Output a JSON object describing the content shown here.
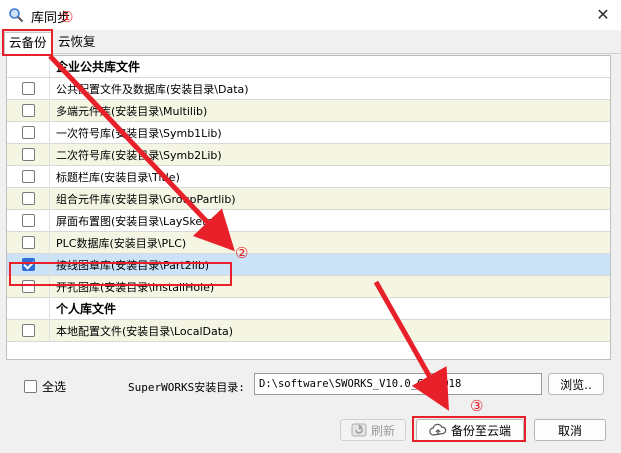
{
  "window": {
    "title": "库同步",
    "close_glyph": "✕"
  },
  "tabs": [
    {
      "label": "云备份",
      "active": true
    },
    {
      "label": "云恢复",
      "active": false
    }
  ],
  "sections": {
    "enterprise": "企业公共库文件",
    "personal": "个人库文件"
  },
  "items": [
    {
      "label": "公共配置文件及数据库(安装目录\\Data)",
      "checked": false
    },
    {
      "label": "多端元件库(安装目录\\Multilib)",
      "checked": false
    },
    {
      "label": "一次符号库(安装目录\\Symb1Lib)",
      "checked": false
    },
    {
      "label": "二次符号库(安装目录\\Symb2Lib)",
      "checked": false
    },
    {
      "label": "标题栏库(安装目录\\Title)",
      "checked": false
    },
    {
      "label": "组合元件库(安装目录\\GroupPartlib)",
      "checked": false
    },
    {
      "label": "屏面布置图(安装目录\\LaySketch)",
      "checked": false
    },
    {
      "label": "PLC数据库(安装目录\\PLC)",
      "checked": false
    },
    {
      "label": "接线图章库(安装目录\\Part2lib)",
      "checked": true
    },
    {
      "label": "开孔图库(安装目录\\InstallHole)",
      "checked": false
    },
    {
      "label": "本地配置文件(安装目录\\LocalData)",
      "checked": false
    }
  ],
  "footer": {
    "select_all": "全选",
    "path_label": "SuperWORKS安装目录:",
    "path_value": "D:\\software\\SWORKS_V10.0_CAD2018",
    "browse": "浏览.."
  },
  "buttons": {
    "refresh": "刷新",
    "backup": "备份至云端",
    "cancel": "取消"
  },
  "annotations": [
    "①",
    "②",
    "③"
  ],
  "colors": {
    "annotation_red": "#e8202a",
    "selected_row": "#cce3f7",
    "checkbox_blue": "#2d6fd6"
  }
}
